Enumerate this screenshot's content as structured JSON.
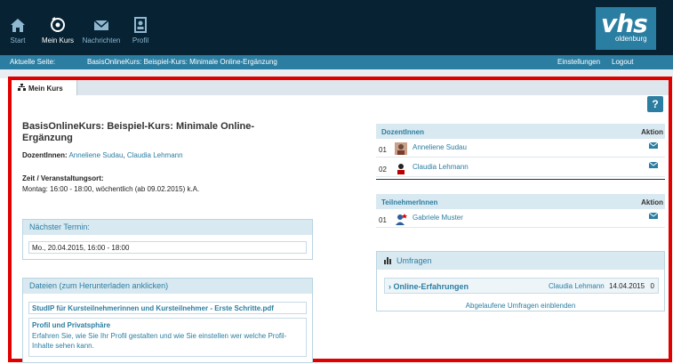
{
  "nav": {
    "items": [
      {
        "label": "Start",
        "icon": "home-icon"
      },
      {
        "label": "Mein Kurs",
        "icon": "course-icon"
      },
      {
        "label": "Nachrichten",
        "icon": "mail-icon"
      },
      {
        "label": "Profil",
        "icon": "profile-icon"
      }
    ],
    "logo_text": "vhs",
    "logo_sub": "oldenburg"
  },
  "breadcrumb": {
    "label": "Aktuelle Seite:",
    "path": "BasisOnlineKurs: Beispiel-Kurs: Minimale Online-Ergänzung",
    "settings": "Einstellungen",
    "logout": "Logout"
  },
  "tab": {
    "label": "Mein Kurs"
  },
  "help": {
    "label": "?"
  },
  "course": {
    "title": "BasisOnlineKurs: Beispiel-Kurs: Minimale Online-Ergänzung",
    "teachers_label": "DozentInnen:",
    "teacher_1": "Anneliene Sudau",
    "teacher_sep": ", ",
    "teacher_2": "Claudia Lehmann",
    "time_label": "Zeit / Veranstaltungsort:",
    "time_value": "Montag: 16:00 - 18:00, wöchentlich (ab 09.02.2015) k.A."
  },
  "next_date": {
    "header": "Nächster Termin:",
    "value": "Mo., 20.04.2015, 16:00 - 18:00"
  },
  "files": {
    "header": "Dateien (zum Herunterladen anklicken)",
    "file_1": "StudIP für Kursteilnehmerinnen und Kursteilnehmer - Erste Schritte.pdf",
    "file_2_title": "Profil und Privatsphäre",
    "file_2_desc": "Erfahren Sie, wie Sie Ihr Profil gestalten und wie Sie einstellen wer welche Profil-Inhalte sehen kann."
  },
  "teachers_table": {
    "header": "DozentInnen",
    "action": "Aktion",
    "rows": [
      {
        "num": "01",
        "name": "Anneliene Sudau"
      },
      {
        "num": "02",
        "name": "Claudia Lehmann"
      }
    ]
  },
  "participants_table": {
    "header": "TeilnehmerInnen",
    "action": "Aktion",
    "rows": [
      {
        "num": "01",
        "name": "Gabriele Muster"
      }
    ]
  },
  "polls": {
    "header": "Umfragen",
    "entry_title": "Online-Erfahrungen",
    "entry_author": "Claudia Lehmann",
    "entry_date": "14.04.2015",
    "entry_count": "0",
    "footer": "Abgelaufene Umfragen einblenden"
  },
  "colors": {
    "topbar": "#062233",
    "accent": "#2b7ea1",
    "highlight_frame": "#e00000"
  }
}
